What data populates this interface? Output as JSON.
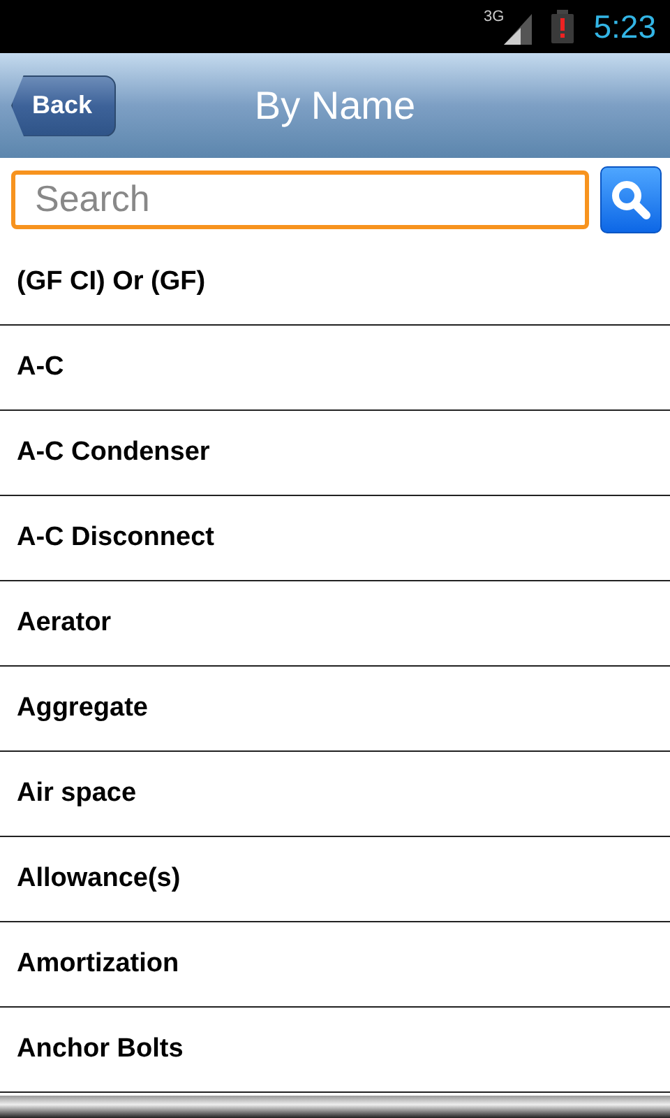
{
  "status_bar": {
    "network": "3G",
    "time": "5:23"
  },
  "header": {
    "back": "Back",
    "title": "By Name"
  },
  "search": {
    "placeholder": "Search"
  },
  "items": [
    "(GF CI) Or (GF)",
    "A-C",
    "A-C Condenser",
    "A-C Disconnect",
    "Aerator",
    "Aggregate",
    "Air space",
    "Allowance(s)",
    "Amortization",
    "Anchor Bolts"
  ]
}
